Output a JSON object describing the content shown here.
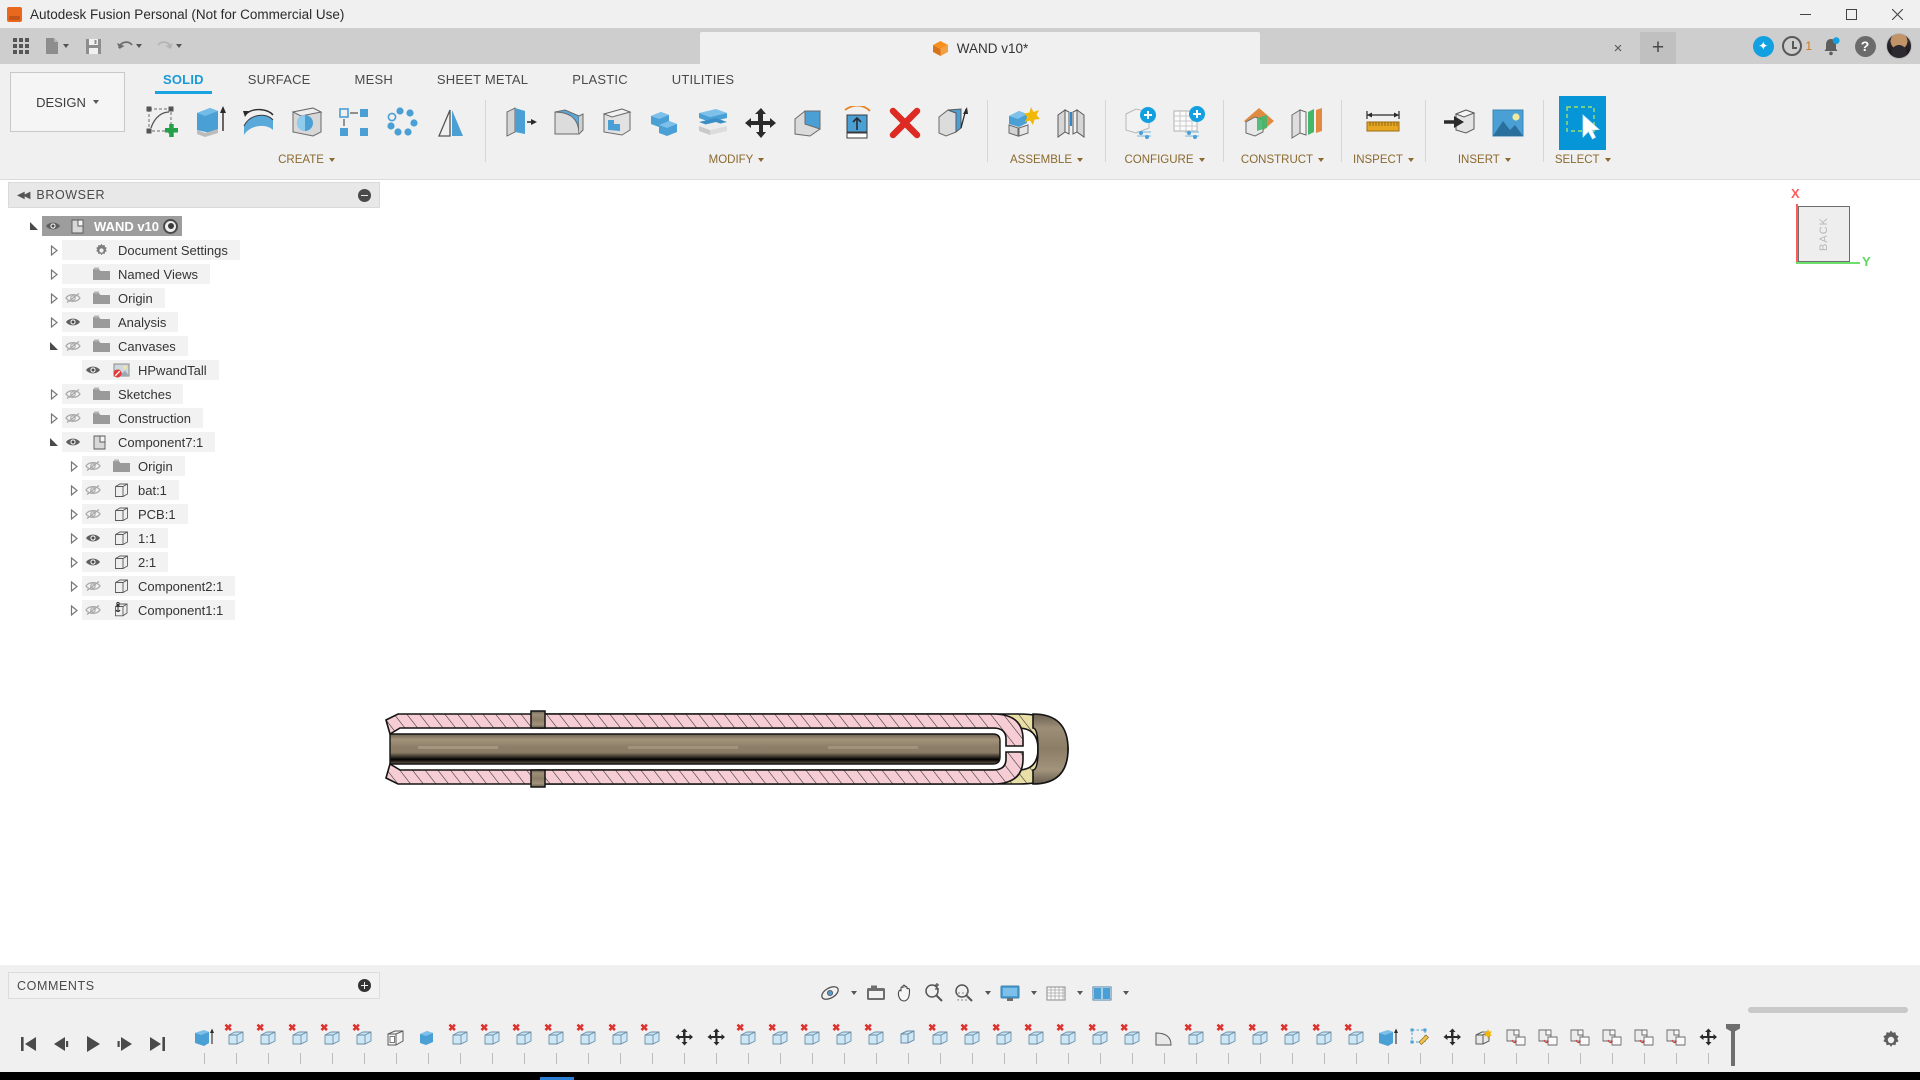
{
  "window": {
    "app_title": "Autodesk Fusion Personal (Not for Commercial Use)",
    "minimize_label": "minimize",
    "maximize_label": "maximize",
    "close_label": "close"
  },
  "quick_access": {
    "items": [
      {
        "name": "app-grid-icon",
        "label": "Show Data Panel"
      },
      {
        "name": "file-icon",
        "label": "File"
      },
      {
        "name": "save-icon",
        "label": "Save"
      },
      {
        "name": "undo-icon",
        "label": "Undo"
      },
      {
        "name": "redo-icon",
        "label": "Redo"
      }
    ]
  },
  "document_tab": {
    "icon": "fusion-cube-icon",
    "name": "WAND v10*",
    "close_label": "×",
    "new_tab_label": "+"
  },
  "account_bar": {
    "extension_icon": "fusion-360-extension-icon",
    "job_status_icon": "job-status-clock-icon",
    "job_count": "1",
    "notifications_icon": "bell-icon",
    "help_icon": "help-icon",
    "avatar_icon": "user-avatar"
  },
  "workspace": {
    "label": "DESIGN"
  },
  "ribbon": {
    "tabs": [
      {
        "label": "SOLID",
        "active": true
      },
      {
        "label": "SURFACE",
        "active": false
      },
      {
        "label": "MESH",
        "active": false
      },
      {
        "label": "SHEET METAL",
        "active": false
      },
      {
        "label": "PLASTIC",
        "active": false
      },
      {
        "label": "UTILITIES",
        "active": false
      }
    ],
    "panels": [
      {
        "label": "CREATE",
        "has_dropdown": true,
        "tools": [
          {
            "name": "create-sketch-icon",
            "label": "Create Sketch"
          },
          {
            "name": "extrude-icon",
            "label": "Extrude"
          },
          {
            "name": "revolve-icon",
            "label": "Revolve"
          },
          {
            "name": "sweep-icon",
            "label": "Sweep"
          },
          {
            "name": "rectangular-pattern-icon",
            "label": "Rectangular Pattern"
          },
          {
            "name": "circular-pattern-icon",
            "label": "Circular Pattern"
          },
          {
            "name": "mirror-icon",
            "label": "Mirror"
          }
        ]
      },
      {
        "label": "MODIFY",
        "has_dropdown": true,
        "tools": [
          {
            "name": "press-pull-icon",
            "label": "Press Pull"
          },
          {
            "name": "fillet-icon",
            "label": "Fillet"
          },
          {
            "name": "shell-icon",
            "label": "Shell"
          },
          {
            "name": "combine-icon",
            "label": "Combine"
          },
          {
            "name": "offset-face-icon",
            "label": "Offset Face"
          },
          {
            "name": "move-copy-icon",
            "label": "Move/Copy"
          },
          {
            "name": "split-face-icon",
            "label": "Split Face"
          },
          {
            "name": "split-body-icon",
            "label": "Split Body"
          },
          {
            "name": "delete-icon",
            "label": "Delete"
          },
          {
            "name": "draft-icon",
            "label": "Draft"
          }
        ]
      },
      {
        "label": "ASSEMBLE",
        "has_dropdown": true,
        "tools": [
          {
            "name": "new-component-icon",
            "label": "New Component"
          },
          {
            "name": "joint-icon",
            "label": "Joint"
          }
        ]
      },
      {
        "label": "CONFIGURE",
        "has_dropdown": true,
        "tools": [
          {
            "name": "create-configuration-icon",
            "label": "Create Configuration"
          },
          {
            "name": "configuration-table-icon",
            "label": "Configuration Table"
          }
        ]
      },
      {
        "label": "CONSTRUCT",
        "has_dropdown": true,
        "tools": [
          {
            "name": "offset-plane-icon",
            "label": "Offset Plane"
          },
          {
            "name": "plane-along-path-icon",
            "label": "Plane Along Path"
          }
        ]
      },
      {
        "label": "INSPECT",
        "has_dropdown": true,
        "tools": [
          {
            "name": "measure-icon",
            "label": "Measure"
          }
        ]
      },
      {
        "label": "INSERT",
        "has_dropdown": true,
        "tools": [
          {
            "name": "insert-derive-icon",
            "label": "Insert Derive"
          },
          {
            "name": "canvas-icon",
            "label": "Canvas"
          }
        ]
      },
      {
        "label": "SELECT",
        "has_dropdown": true,
        "tools": [
          {
            "name": "select-icon",
            "label": "Select",
            "selected": true
          }
        ]
      }
    ]
  },
  "browser": {
    "title": "BROWSER",
    "collapse_icon": "double-left-arrow-icon",
    "toggle_icon": "minus-circle-icon",
    "nodes": [
      {
        "label": "WAND v10",
        "indent": 0,
        "expander": "open",
        "eye": "visible",
        "icon": "component-icon",
        "root": true,
        "radio": true
      },
      {
        "label": "Document Settings",
        "indent": 1,
        "expander": "closed",
        "eye": "none",
        "icon": "gear-icon"
      },
      {
        "label": "Named Views",
        "indent": 1,
        "expander": "closed",
        "eye": "none",
        "icon": "folder-icon"
      },
      {
        "label": "Origin",
        "indent": 1,
        "expander": "closed",
        "eye": "hidden",
        "icon": "folder-icon"
      },
      {
        "label": "Analysis",
        "indent": 1,
        "expander": "closed",
        "eye": "visible",
        "icon": "folder-icon"
      },
      {
        "label": "Canvases",
        "indent": 1,
        "expander": "open",
        "eye": "hidden",
        "icon": "folder-icon"
      },
      {
        "label": "HPwandTall",
        "indent": 2,
        "expander": "none",
        "eye": "visible",
        "icon": "canvas-image-icon"
      },
      {
        "label": "Sketches",
        "indent": 1,
        "expander": "closed",
        "eye": "hidden",
        "icon": "folder-icon"
      },
      {
        "label": "Construction",
        "indent": 1,
        "expander": "closed",
        "eye": "hidden",
        "icon": "folder-icon"
      },
      {
        "label": "Component7:1",
        "indent": 1,
        "expander": "open",
        "eye": "visible",
        "icon": "component-icon"
      },
      {
        "label": "Origin",
        "indent": 2,
        "expander": "closed",
        "eye": "hidden",
        "icon": "folder-icon"
      },
      {
        "label": "bat:1",
        "indent": 2,
        "expander": "closed",
        "eye": "hidden",
        "icon": "body-icon"
      },
      {
        "label": "PCB:1",
        "indent": 2,
        "expander": "closed",
        "eye": "hidden",
        "icon": "body-icon"
      },
      {
        "label": "1:1",
        "indent": 2,
        "expander": "closed",
        "eye": "visible",
        "icon": "body-icon"
      },
      {
        "label": "2:1",
        "indent": 2,
        "expander": "closed",
        "eye": "visible",
        "icon": "body-icon"
      },
      {
        "label": "Component2:1",
        "indent": 2,
        "expander": "closed",
        "eye": "hidden",
        "icon": "body-icon"
      },
      {
        "label": "Component1:1",
        "indent": 2,
        "expander": "closed",
        "eye": "hidden",
        "icon": "grounded-component-icon"
      }
    ]
  },
  "comments": {
    "title": "COMMENTS",
    "add_icon": "plus-circle-icon"
  },
  "viewcube": {
    "face_label": "BACK",
    "axis_x_label": "X",
    "axis_y_label": "Y",
    "axis_x_color": "#ff5b5b",
    "axis_y_color": "#6ce06c"
  },
  "navbar": {
    "items": [
      {
        "name": "orbit-icon",
        "label": "Orbit",
        "caret": true
      },
      {
        "name": "look-at-icon",
        "label": "Look At",
        "caret": false
      },
      {
        "name": "pan-icon",
        "label": "Pan",
        "caret": false
      },
      {
        "name": "zoom-icon",
        "label": "Zoom",
        "caret": false
      },
      {
        "name": "fit-icon",
        "label": "Fit",
        "caret": true
      },
      {
        "name": "display-settings-icon",
        "label": "Display Settings",
        "caret": true
      },
      {
        "name": "grid-snap-icon",
        "label": "Grid and Snaps",
        "caret": true
      },
      {
        "name": "viewports-icon",
        "label": "Viewports",
        "caret": true
      }
    ]
  },
  "timeline": {
    "playback": [
      {
        "name": "jump-to-beginning-icon",
        "label": "Jump to Beginning"
      },
      {
        "name": "step-back-icon",
        "label": "Step Back"
      },
      {
        "name": "play-icon",
        "label": "Play"
      },
      {
        "name": "step-forward-icon",
        "label": "Step Forward"
      },
      {
        "name": "jump-to-end-icon",
        "label": "Jump to End"
      }
    ],
    "settings_icon": "gear-icon",
    "marker_label": "timeline-marker",
    "features": [
      {
        "name": "extrude-feature",
        "type": "extrude",
        "suppressed": false
      },
      {
        "name": "sketch-feature-1",
        "type": "body",
        "suppressed": true
      },
      {
        "name": "sketch-feature-2",
        "type": "body",
        "suppressed": true
      },
      {
        "name": "sketch-feature-3",
        "type": "body",
        "suppressed": true
      },
      {
        "name": "sketch-feature-4",
        "type": "body",
        "suppressed": true
      },
      {
        "name": "sketch-feature-5",
        "type": "body",
        "suppressed": true
      },
      {
        "name": "shell-feature",
        "type": "shell",
        "suppressed": false
      },
      {
        "name": "combine-feature",
        "type": "combine",
        "suppressed": false
      },
      {
        "name": "sketch-feature-6",
        "type": "body",
        "suppressed": true
      },
      {
        "name": "sketch-feature-7",
        "type": "body",
        "suppressed": true
      },
      {
        "name": "sketch-feature-8",
        "type": "body",
        "suppressed": true
      },
      {
        "name": "sketch-feature-9",
        "type": "body",
        "suppressed": true
      },
      {
        "name": "sketch-feature-10",
        "type": "body",
        "suppressed": true
      },
      {
        "name": "sketch-feature-11",
        "type": "body",
        "suppressed": true
      },
      {
        "name": "sketch-feature-12",
        "type": "body",
        "suppressed": true
      },
      {
        "name": "move-feature-1",
        "type": "move",
        "suppressed": false
      },
      {
        "name": "move-feature-2",
        "type": "move",
        "suppressed": false
      },
      {
        "name": "sketch-feature-13",
        "type": "body",
        "suppressed": true
      },
      {
        "name": "sketch-feature-14",
        "type": "body",
        "suppressed": true
      },
      {
        "name": "sketch-feature-15",
        "type": "body",
        "suppressed": true
      },
      {
        "name": "sketch-feature-16",
        "type": "body",
        "suppressed": true
      },
      {
        "name": "sketch-feature-17",
        "type": "body",
        "suppressed": true
      },
      {
        "name": "pattern-feature",
        "type": "pattern",
        "suppressed": false
      },
      {
        "name": "sketch-feature-18",
        "type": "body",
        "suppressed": true
      },
      {
        "name": "sketch-feature-19",
        "type": "body",
        "suppressed": true
      },
      {
        "name": "sketch-feature-20",
        "type": "body",
        "suppressed": true
      },
      {
        "name": "sketch-feature-21",
        "type": "body",
        "suppressed": true
      },
      {
        "name": "sketch-feature-22",
        "type": "body",
        "suppressed": true
      },
      {
        "name": "sketch-feature-23",
        "type": "body",
        "suppressed": true
      },
      {
        "name": "sketch-feature-24",
        "type": "body",
        "suppressed": true
      },
      {
        "name": "fillet-feature",
        "type": "fillet",
        "suppressed": false
      },
      {
        "name": "sketch-feature-25",
        "type": "body",
        "suppressed": true
      },
      {
        "name": "sketch-feature-26",
        "type": "body",
        "suppressed": true
      },
      {
        "name": "sketch-feature-27",
        "type": "body",
        "suppressed": true
      },
      {
        "name": "sketch-feature-28",
        "type": "body",
        "suppressed": true
      },
      {
        "name": "sketch-feature-29",
        "type": "body",
        "suppressed": true
      },
      {
        "name": "sketch-feature-30",
        "type": "body",
        "suppressed": true
      },
      {
        "name": "extrude-feature-2",
        "type": "extrude",
        "suppressed": false
      },
      {
        "name": "edit-sketch-feature",
        "type": "sketch",
        "suppressed": false
      },
      {
        "name": "move-feature-3",
        "type": "move",
        "suppressed": false
      },
      {
        "name": "new-body-feature",
        "type": "newbody",
        "suppressed": false
      },
      {
        "name": "copy-paste-feature-1",
        "type": "copypaste",
        "suppressed": false
      },
      {
        "name": "copy-paste-feature-2",
        "type": "copypaste",
        "suppressed": false
      },
      {
        "name": "copy-paste-feature-3",
        "type": "copypaste",
        "suppressed": false
      },
      {
        "name": "copy-paste-feature-4",
        "type": "copypaste",
        "suppressed": false
      },
      {
        "name": "copy-paste-feature-5",
        "type": "copypaste",
        "suppressed": false
      },
      {
        "name": "copy-paste-feature-6",
        "type": "copypaste",
        "suppressed": false
      },
      {
        "name": "move-feature-4",
        "type": "move",
        "suppressed": false
      }
    ]
  },
  "model": {
    "name": "wand-cross-section",
    "description": "Sectioned cylindrical wand body shown in BACK orthographic view",
    "colors": {
      "hatch_outer": "#e9dfa6",
      "hatch_inner": "#f5c8d0",
      "core": "#8a7a62",
      "outline": "#1a1a1a"
    }
  }
}
